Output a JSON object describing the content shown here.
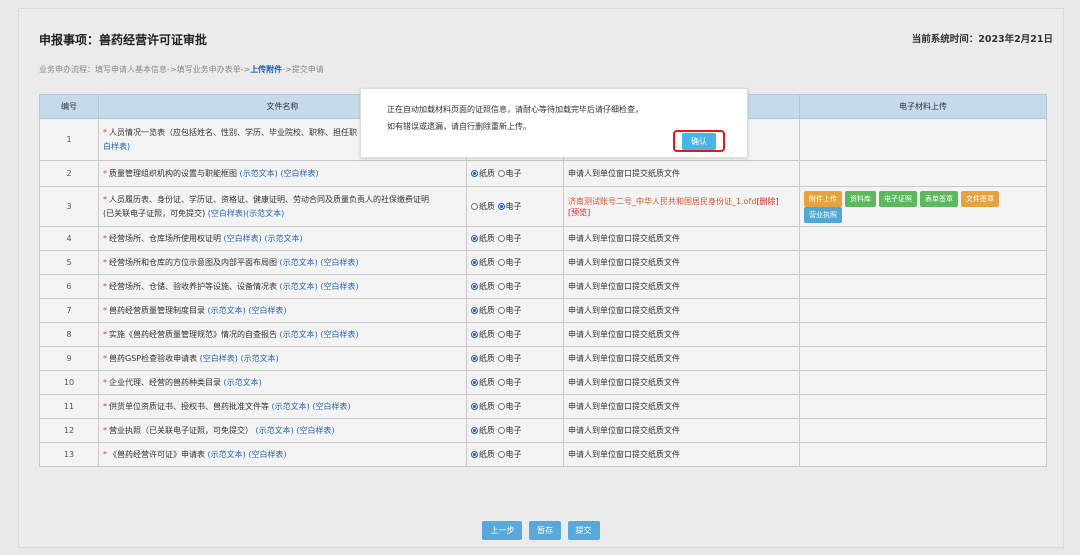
{
  "page": {
    "title": "申报事项：兽药经营许可证审批",
    "date_label": "当前系统时间：2023年2月21日",
    "flow": {
      "step1": "业务申办流程：填写申请人基本信息->填写业务申办表单->",
      "step_active": "上传附件",
      "step3": "->提交申请"
    }
  },
  "table": {
    "headers": [
      "编号",
      "文件名称",
      "",
      "",
      "电子材料上传"
    ],
    "type_options": {
      "paper": "纸质",
      "electronic": "电子"
    },
    "default_note": "申请人到单位窗口提交纸质文件",
    "rows": [
      {
        "num": "1",
        "name": "人员情况一览表（应包括姓名、性别、学历、毕业院校、职称、担任职",
        "name2": "白样表)",
        "links": [],
        "type": "",
        "note": ""
      },
      {
        "num": "2",
        "name": "质量管理组织机构的设置与职能框图",
        "links": [
          "(示范文本)",
          "(空白样表)"
        ],
        "type": "paper",
        "note": "申请人到单位窗口提交纸质文件"
      },
      {
        "num": "3",
        "name": "人员履历表、身份证、学历证、资格证、健康证明、劳动合同及质量负责人的社保缴费证明",
        "name2": "(已关联电子证照，可免提交)",
        "links": [
          "(空白样表)",
          "(示范文本)"
        ],
        "type": "electronic",
        "note": "济南测试账号二号_中华人民共和国居民身份证_1.ofd",
        "note_del": "[删除]",
        "note_preview": "[预览]"
      },
      {
        "num": "4",
        "name": "经营场所、仓库场所使用权证明",
        "links": [
          "(空白样表)",
          "(示范文本)"
        ],
        "type": "paper",
        "note": "申请人到单位窗口提交纸质文件"
      },
      {
        "num": "5",
        "name": "经营场所和仓库的方位示意图及内部平面布局图",
        "links": [
          "(示范文本)",
          "(空白样表)"
        ],
        "type": "paper",
        "note": "申请人到单位窗口提交纸质文件"
      },
      {
        "num": "6",
        "name": "经营场所、仓储、验收养护等设施、设备情况表",
        "links": [
          "(示范文本)",
          "(空白样表)"
        ],
        "type": "paper",
        "note": "申请人到单位窗口提交纸质文件"
      },
      {
        "num": "7",
        "name": "兽药经营质量管理制度目录",
        "links": [
          "(示范文本)",
          "(空白样表)"
        ],
        "type": "paper",
        "note": "申请人到单位窗口提交纸质文件"
      },
      {
        "num": "8",
        "name": "实施《兽药经营质量管理规范》情况的自查报告",
        "links": [
          "(示范文本)",
          "(空白样表)"
        ],
        "type": "paper",
        "note": "申请人到单位窗口提交纸质文件"
      },
      {
        "num": "9",
        "name": "兽药GSP检查验收申请表",
        "links": [
          "(空白样表)",
          "(示范文本)"
        ],
        "type": "paper",
        "note": "申请人到单位窗口提交纸质文件"
      },
      {
        "num": "10",
        "name": "企业代理、经营的兽药种类目录",
        "links": [
          "(示范文本)"
        ],
        "type": "paper",
        "note": "申请人到单位窗口提交纸质文件"
      },
      {
        "num": "11",
        "name": "供货单位资质证书、授权书、兽药批准文件等",
        "links": [
          "(示范文本)",
          "(空白样表)"
        ],
        "type": "paper",
        "note": "申请人到单位窗口提交纸质文件"
      },
      {
        "num": "12",
        "name": "营业执照（已关联电子证照，可免提交）",
        "links": [
          "(示范文本)",
          "(空白样表)"
        ],
        "type": "paper",
        "note": "申请人到单位窗口提交纸质文件"
      },
      {
        "num": "13",
        "name": "《兽药经营许可证》申请表",
        "links": [
          "(示范文本)",
          "(空白样表)"
        ],
        "type": "paper",
        "note": "申请人到单位窗口提交纸质文件"
      }
    ],
    "row3_buttons": [
      "附件上传",
      "资料库",
      "电子证照",
      "表单签章",
      "文件签章",
      "营业执照"
    ]
  },
  "bottom": {
    "prev": "上一步",
    "save": "暂存",
    "submit": "提交"
  },
  "modal": {
    "line1": "正在自动加载材料页面的证照信息，请耐心等待加载完毕后请仔细检查，",
    "line2": "如有错误或遗漏，请自行删除重新上传。",
    "confirm": "确认"
  },
  "colors": {
    "accent": "#4ab3e8",
    "highlight": "#e01a1a",
    "header_bg": "#c5dbe9"
  }
}
